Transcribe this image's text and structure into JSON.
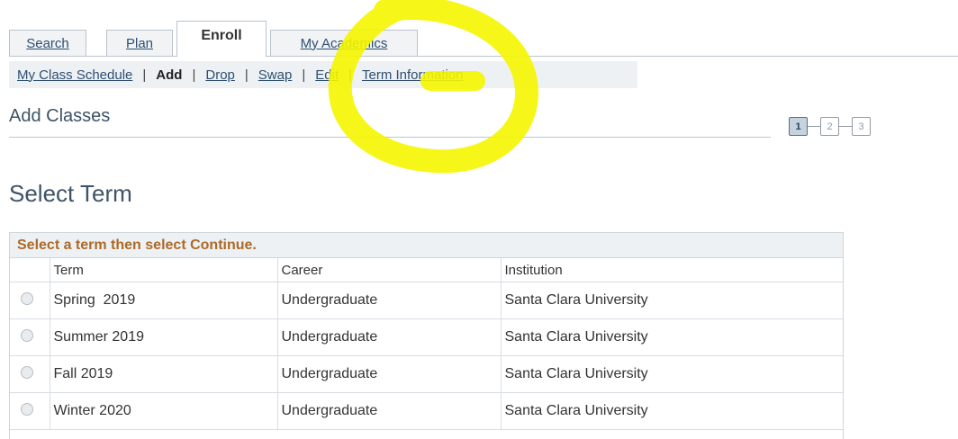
{
  "tabs": [
    {
      "label": "Search",
      "active": false
    },
    {
      "label": "Plan",
      "active": false
    },
    {
      "label": "Enroll",
      "active": true
    },
    {
      "label": "My Academics",
      "active": false
    }
  ],
  "subnav": {
    "items": [
      "My Class Schedule",
      "Add",
      "Drop",
      "Swap",
      "Edit",
      "Term Information"
    ],
    "separator": "|",
    "current": "Add"
  },
  "page_title": "Add Classes",
  "steps": [
    "1",
    "2",
    "3"
  ],
  "section_title": "Select Term",
  "grid": {
    "caption": "Select a term then select Continue.",
    "columns": [
      "Term",
      "Career",
      "Institution"
    ],
    "rows": [
      {
        "term": "Spring  2019",
        "career": "Undergraduate",
        "institution": "Santa Clara University"
      },
      {
        "term": "Summer 2019",
        "career": "Undergraduate",
        "institution": "Santa Clara University"
      },
      {
        "term": "Fall 2019",
        "career": "Undergraduate",
        "institution": "Santa Clara University"
      },
      {
        "term": "Winter 2020",
        "career": "Undergraduate",
        "institution": "Santa Clara University"
      }
    ]
  },
  "colors": {
    "annotation": "#f5f500",
    "caption_text": "#ac6a27",
    "link": "#2d4f70"
  }
}
